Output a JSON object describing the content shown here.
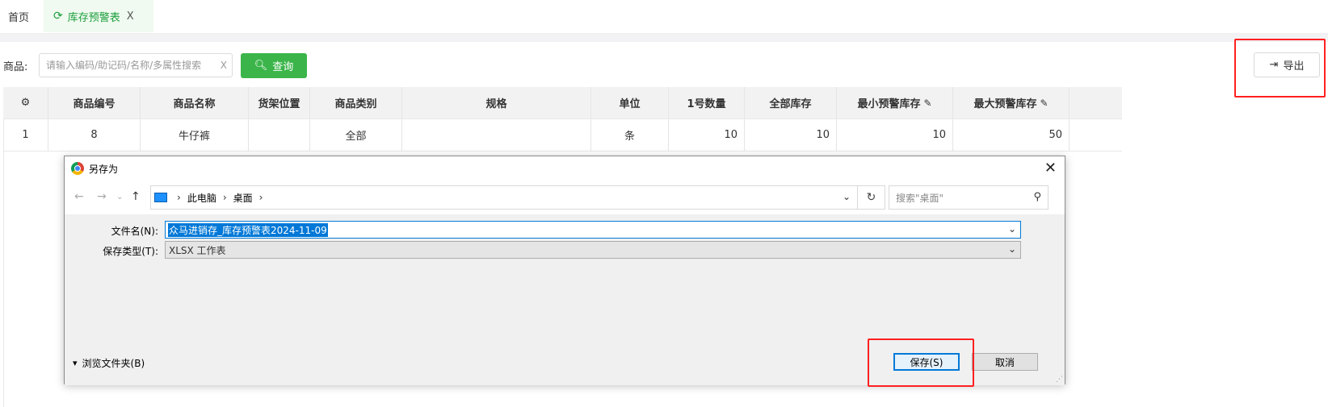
{
  "tabs": {
    "home": "首页",
    "active": "库存预警表",
    "close": "X"
  },
  "search": {
    "label": "商品:",
    "placeholder": "请输入编码/助记码/名称/多属性搜索",
    "clear": "X",
    "query_label": "查询",
    "export_label": "导出"
  },
  "table": {
    "columns": [
      {
        "key": "seq",
        "label": "",
        "width": 56
      },
      {
        "key": "code",
        "label": "商品编号",
        "width": 114
      },
      {
        "key": "name",
        "label": "商品名称",
        "width": 134
      },
      {
        "key": "shelf",
        "label": "货架位置",
        "width": 76
      },
      {
        "key": "category",
        "label": "商品类别",
        "width": 114
      },
      {
        "key": "spec",
        "label": "规格",
        "width": 234
      },
      {
        "key": "unit",
        "label": "单位",
        "width": 96
      },
      {
        "key": "qty1",
        "label": "1号数量",
        "width": 94
      },
      {
        "key": "total",
        "label": "全部库存",
        "width": 114
      },
      {
        "key": "min",
        "label": "最小预警库存",
        "width": 144
      },
      {
        "key": "max",
        "label": "最大预警库存",
        "width": 144
      }
    ],
    "rows": [
      {
        "seq": "1",
        "code": "8",
        "name": "牛仔裤",
        "shelf": "",
        "category": "全部",
        "spec": "",
        "unit": "条",
        "qty1": "10",
        "total": "10",
        "min": "10",
        "max": "50"
      }
    ]
  },
  "dialog": {
    "title": "另存为",
    "close": "✕",
    "breadcrumb": [
      "此电脑",
      "桌面"
    ],
    "search_placeholder": "搜索\"桌面\"",
    "filename_label": "文件名(N):",
    "filename_value": "众马进销存_库存预警表2024-11-09",
    "filetype_label": "保存类型(T):",
    "filetype_value": "XLSX 工作表",
    "browse_label": "浏览文件夹(B)",
    "save_label": "保存(S)",
    "cancel_label": "取消"
  },
  "colors": {
    "accent_green": "#3bb54a",
    "highlight_red": "#ff2020",
    "win_blue": "#0078d7"
  }
}
